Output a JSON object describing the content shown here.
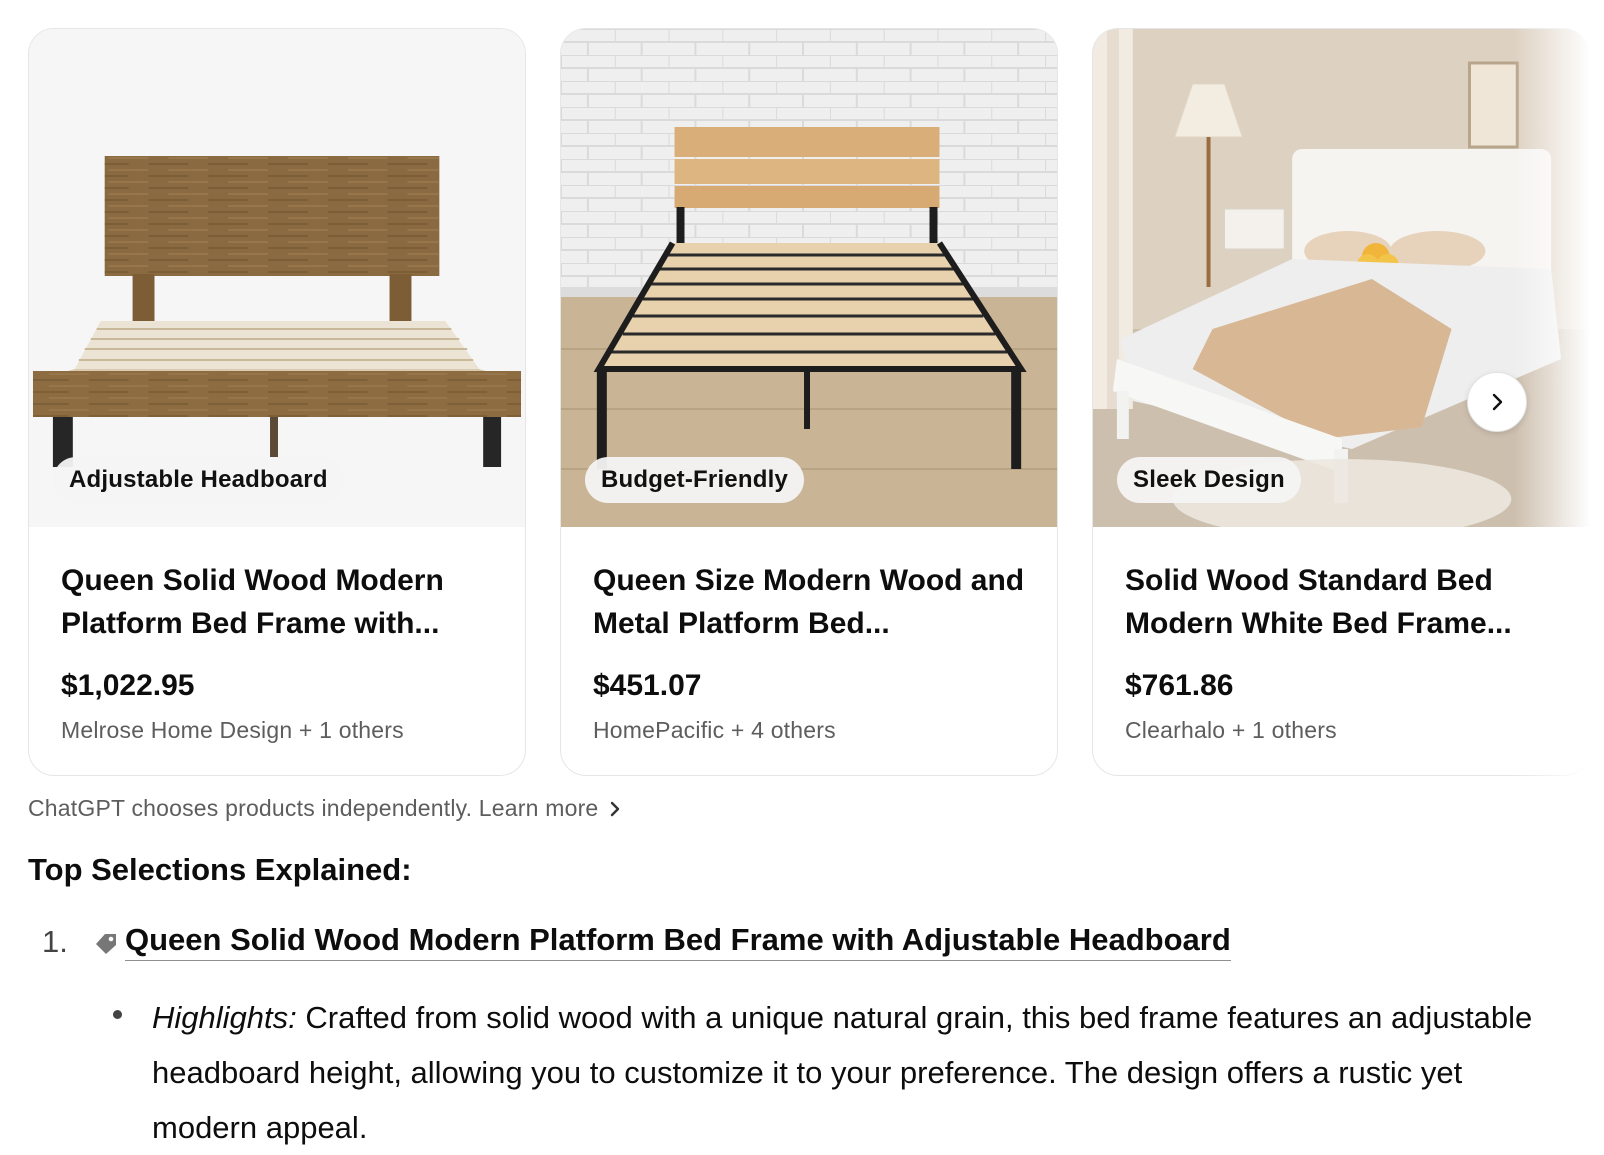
{
  "carousel": {
    "products": [
      {
        "badge": "Adjustable Headboard",
        "title": "Queen Solid Wood Modern Platform Bed Frame with...",
        "price": "$1,022.95",
        "sellers": "Melrose Home Design + 1 others"
      },
      {
        "badge": "Budget-Friendly",
        "title": "Queen Size Modern Wood and Metal Platform Bed...",
        "price": "$451.07",
        "sellers": "HomePacific + 4 others"
      },
      {
        "badge": "Sleek Design",
        "title": "Solid Wood Standard Bed Modern White Bed Frame...",
        "price": "$761.86",
        "sellers": "Clearhalo + 1 others"
      }
    ],
    "next_icon": "chevron-right-icon"
  },
  "disclaimer": {
    "text": "ChatGPT chooses products independently. Learn more",
    "icon": "chevron-right-icon"
  },
  "content": {
    "heading": "Top Selections Explained:",
    "items": [
      {
        "number": "1.",
        "icon": "tag-icon",
        "link": "Queen Solid Wood Modern Platform Bed Frame with Adjustable Headboard",
        "highlights_label": "Highlights:",
        "highlights_text": " Crafted from solid wood with a unique natural grain, this bed frame features an adjustable headboard height, allowing you to customize it to your preference. The design offers a rustic yet modern appeal."
      }
    ]
  },
  "colors": {
    "text": "#0d0d0d",
    "muted": "#5d5d5d",
    "border": "#e6e6e6"
  }
}
